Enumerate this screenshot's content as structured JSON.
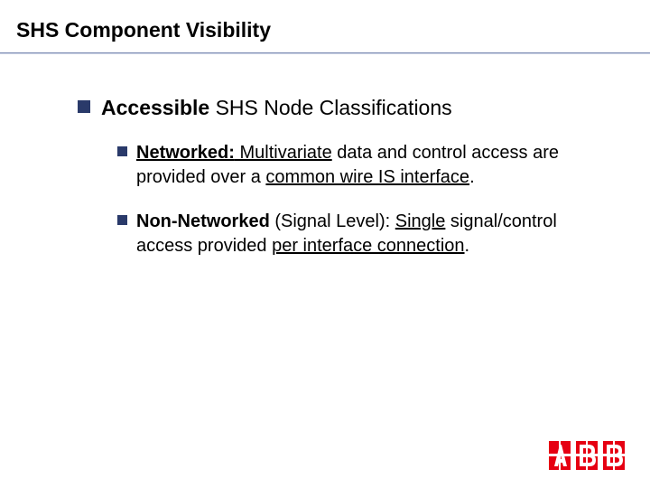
{
  "title": "SHS Component Visibility",
  "lvl1": {
    "strong": "Accessible",
    "rest": " SHS Node Classifications"
  },
  "item1": {
    "lead_bold_u": "Networked:",
    "seg1_u": " Multivariate",
    "seg2": " data and control access are provided over a ",
    "seg3_u": "common wire IS interface",
    "seg4": "."
  },
  "item2": {
    "lead_bold": "Non-Networked",
    "seg1": " (Signal Level): ",
    "seg2_u": "Single",
    "seg3": " signal/control access provided ",
    "seg4_u": "per interface connection",
    "seg5": "."
  },
  "logo": {
    "name": "ABB",
    "color": "#e60012"
  }
}
